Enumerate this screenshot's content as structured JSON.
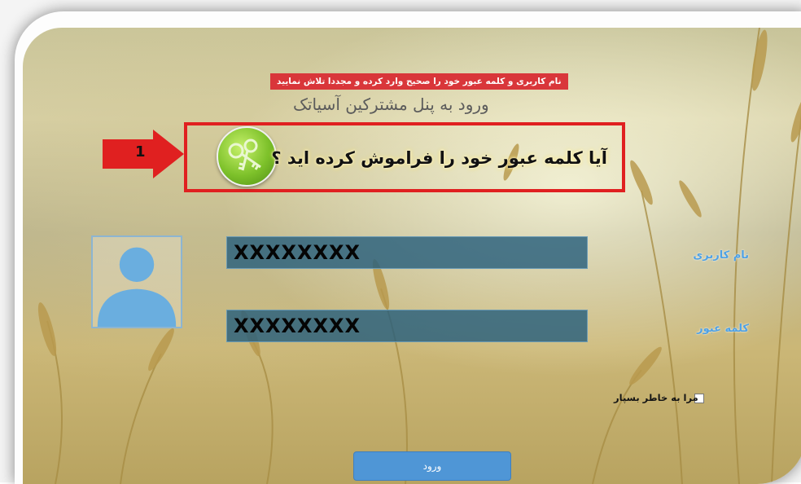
{
  "error_message": "نام کاربری و کلمه عبور خود را صحیح وارد کرده و مجددا تلاش نمایید",
  "portal_title": "ورود به پنل مشترکین آسیاتک",
  "forgot_password_link": "آیا کلمه عبور خود را فراموش کرده اید ؟",
  "annotation": {
    "step_number": "1"
  },
  "username": {
    "label": "نام کاربری",
    "value": "XXXXXXXX"
  },
  "password": {
    "label": "کلمه عبور",
    "value": "XXXXXXXX"
  },
  "remember_me": {
    "label": "مرا به خاطر بسپار",
    "checked": false
  },
  "login_button": "ورود",
  "colors": {
    "error_bg": "#d9363a",
    "highlight": "#e02020",
    "label": "#4ea1e5",
    "button": "#4f96d6",
    "field": "#285f7d"
  },
  "icons": [
    "key-icon",
    "user-avatar-icon",
    "arrow-right-icon"
  ]
}
